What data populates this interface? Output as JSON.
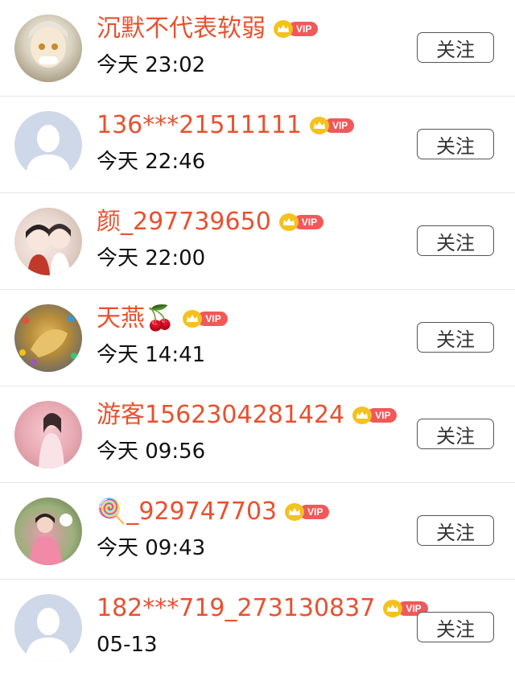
{
  "colors": {
    "name": "#e8512f",
    "vip_badge": "#f2585a",
    "vip_crown": "#f4c21e",
    "text": "#111111",
    "divider": "#e6e6e6"
  },
  "vip_label": "VIP",
  "follow_label": "关注",
  "users": [
    {
      "name": "沉默不代表软弱",
      "time": "今天 23:02",
      "avatar": "anime-character-avatar"
    },
    {
      "name": "136***21511111",
      "time": "今天 22:46",
      "avatar": "default-avatar"
    },
    {
      "name": "颜_297739650",
      "time": "今天 22:00",
      "avatar": "cartoon-couple-avatar"
    },
    {
      "name": "天燕🍒",
      "time": "今天 14:41",
      "avatar": "photo-avatar"
    },
    {
      "name": "游客1562304281424",
      "time": "今天 09:56",
      "avatar": "photo-avatar"
    },
    {
      "name": "🍭_929747703",
      "time": "今天 09:43",
      "avatar": "photo-avatar"
    },
    {
      "name": "182***719_273130837",
      "time": "05-13",
      "avatar": "default-avatar"
    }
  ]
}
